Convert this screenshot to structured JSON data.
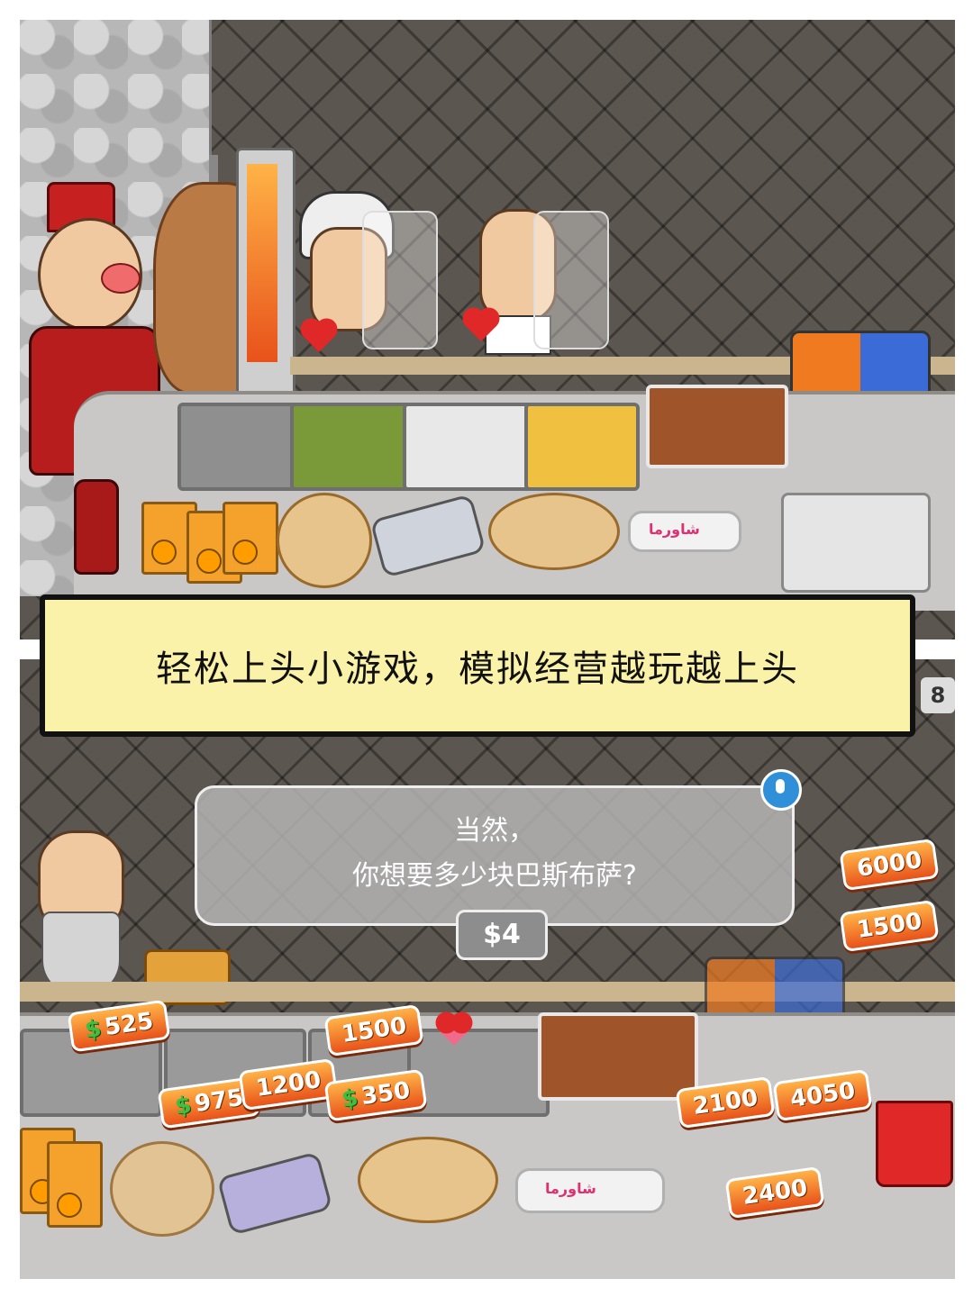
{
  "banner": {
    "text": "轻松上头小游戏，模拟经营越玩越上头"
  },
  "dialog": {
    "line1": "当然，",
    "line2": "你想要多少块巴斯布萨?",
    "price": "$4"
  },
  "wrap_label": "شاورما",
  "juice_label": "ORANGE",
  "upgrade_prices": [
    {
      "label": "525",
      "has_dollar": true
    },
    {
      "label": "975",
      "has_dollar": true
    },
    {
      "label": "1200",
      "has_dollar": false
    },
    {
      "label": "350",
      "has_dollar": true
    },
    {
      "label": "1500",
      "has_dollar": false
    },
    {
      "label": "2100",
      "has_dollar": false
    },
    {
      "label": "4050",
      "has_dollar": false
    },
    {
      "label": "2400",
      "has_dollar": false
    },
    {
      "label": "6000",
      "has_dollar": false
    },
    {
      "label": "1500",
      "has_dollar": false
    }
  ],
  "coin_counter_partial": "8",
  "colors": {
    "banner_bg": "#faf2a8",
    "tag_orange": "#e8521a",
    "wall": "#5c5650"
  },
  "icons": [
    "heart-icon",
    "microphone-icon",
    "dollar-icon",
    "check-icon",
    "cross-icon"
  ]
}
